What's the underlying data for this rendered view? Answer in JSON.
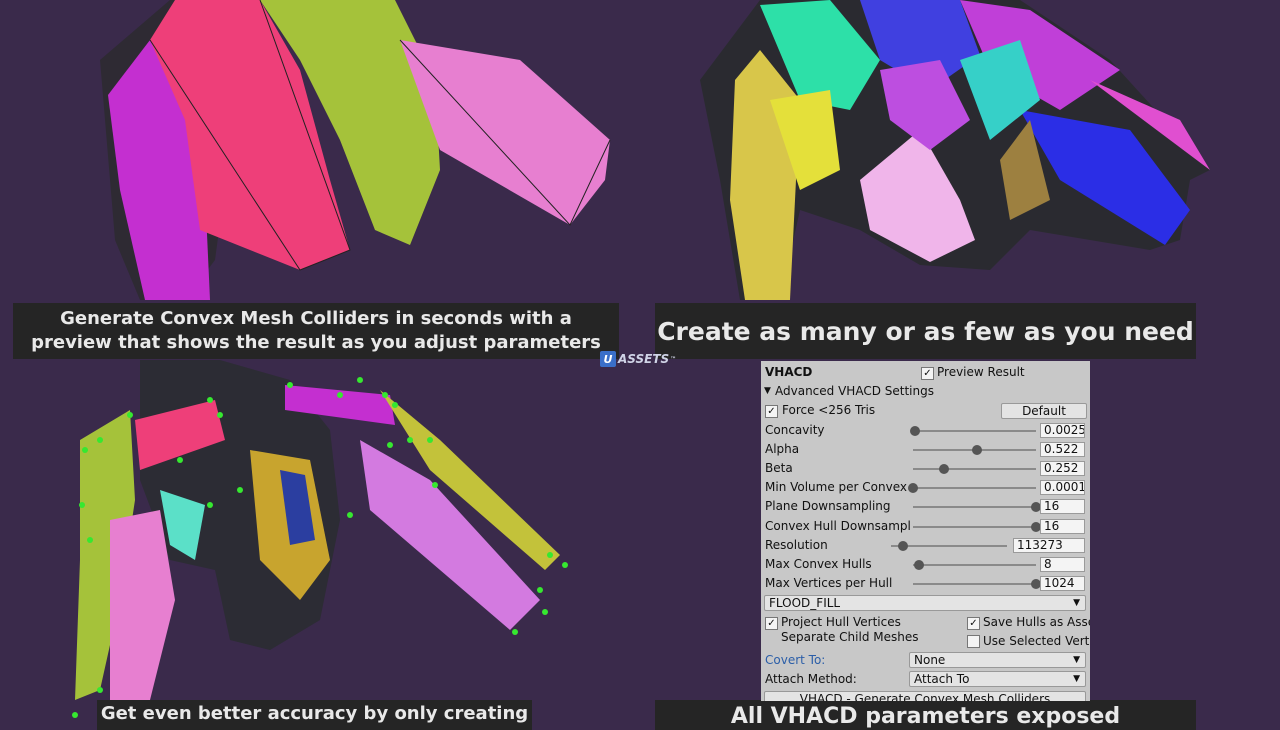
{
  "captions": {
    "top_left": "Generate Convex Mesh Colliders in seconds with a\npreview that shows the result as you adjust parameters",
    "top_right": "Create as many or as few as you need",
    "bottom_left": "Get even better accuracy by only creating",
    "bottom_right": "All VHACD parameters exposed"
  },
  "logo": {
    "letter": "U",
    "text": "ASSETS",
    "tm": "™"
  },
  "inspector": {
    "title": "VHACD",
    "preview_result": {
      "label": "Preview Result",
      "checked": true
    },
    "advanced_foldout": "Advanced VHACD Settings",
    "force_256": {
      "label": "Force <256 Tris",
      "checked": true
    },
    "default_button": "Default",
    "sliders": [
      {
        "label": "Concavity",
        "value": "0.0025",
        "fill": 0.02
      },
      {
        "label": "Alpha",
        "value": "0.522",
        "fill": 0.52
      },
      {
        "label": "Beta",
        "value": "0.252",
        "fill": 0.25
      },
      {
        "label": "Min Volume per Convex Hu",
        "value": "0.0001",
        "fill": 0.0
      },
      {
        "label": "Plane Downsampling",
        "value": "16",
        "fill": 1.0
      },
      {
        "label": "Convex Hull Downsampling",
        "value": "16",
        "fill": 1.0
      },
      {
        "label": "Resolution",
        "value": "113273",
        "fill": 0.1
      },
      {
        "label": "Max Convex Hulls",
        "value": "8",
        "fill": 0.05
      },
      {
        "label": "Max Vertices per Hull",
        "value": "1024",
        "fill": 1.0
      }
    ],
    "mode_select": "FLOOD_FILL",
    "project_hull_vertices": {
      "label": "Project Hull Vertices",
      "checked": true
    },
    "save_hulls_as_asset": {
      "label": "Save Hulls as Asset",
      "checked": true
    },
    "separate_child_meshes": {
      "label": "Separate Child Meshes",
      "checked": false
    },
    "use_selected_verts": {
      "label": "Use Selected Verts",
      "checked": false
    },
    "covert_to": {
      "label": "Covert To:",
      "value": "None"
    },
    "attach_method": {
      "label": "Attach Method:",
      "value": "Attach To"
    },
    "generate_button": "VHACD - Generate Convex Mesh Colliders"
  },
  "colors": {
    "background": "#3a2a4b",
    "caption_bg": "#252525",
    "caption_text": "#e9e9e9",
    "inspector_bg": "#c8c8c8",
    "link_blue": "#2b5ea8"
  }
}
